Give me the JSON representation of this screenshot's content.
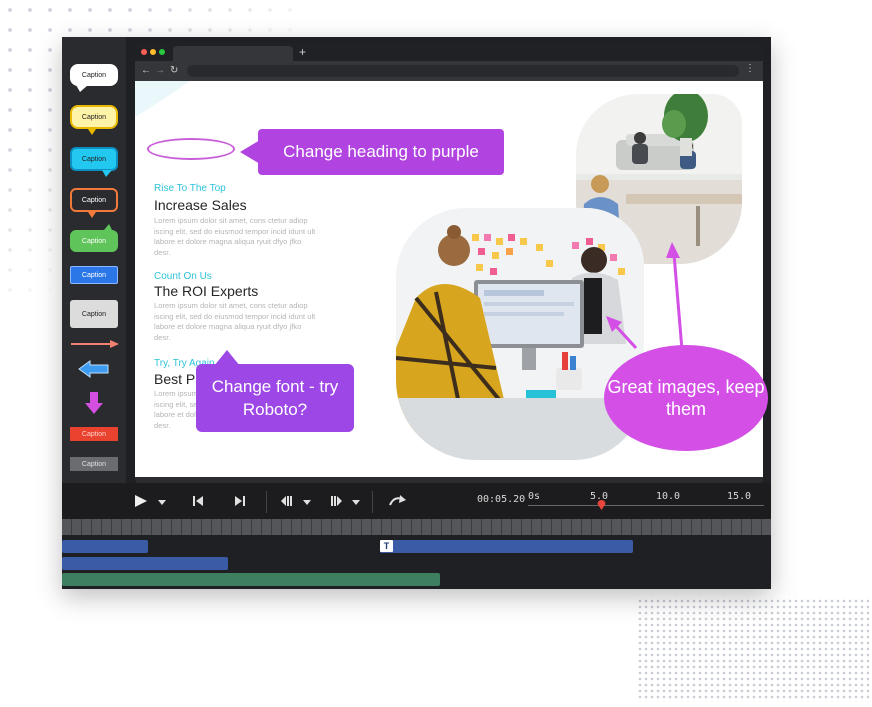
{
  "palette": {
    "items": [
      "Caption",
      "Caption",
      "Caption",
      "Caption",
      "Caption",
      "Caption",
      "Caption",
      "Caption",
      "Caption"
    ]
  },
  "browser": {
    "new_tab_label": "+",
    "menu_label": "⋮"
  },
  "page": {
    "sections": [
      {
        "label": "Rise To The Top",
        "title": "Increase Sales",
        "body": "Lorem ipsum dolor sit amet, cons ctetur adiop iscing elit, sed do eiusmod tempor incid idunt ult labore et dolore magna aliqua ryuit dfyo jfko desr."
      },
      {
        "label": "Count On Us",
        "title": "The ROI Experts",
        "body": "Lorem ipsum dolor sit amet, cons ctetur adiop iscing elit, sed do eiusmod tempor incid idunt ult labore et dolore magna aliqua ryuit dfyo jfko desr."
      },
      {
        "label": "Try, Try Again",
        "title": "Best Practices",
        "body": "Lorem ipsum dolor sit amet, cons ctetur adiop iscing elit, sed do eiusmod tempor incid idunt ult labore et dolore magna aliqua ryuit dfyo jfko desr."
      }
    ]
  },
  "annotations": {
    "heading_callout": "Change heading to purple",
    "font_callout": "Change font - try Roboto?",
    "images_callout": "Great images, keep them"
  },
  "player": {
    "timecode": "00:05.20",
    "ruler_labels": [
      "0s",
      "5.0",
      "10.0",
      "15.0"
    ],
    "playhead_seconds": 5.2
  },
  "timeline": {
    "text_clip_icon": "T"
  },
  "colors": {
    "accent_purple": "#b144e0",
    "heading_cyan": "#2ec3d8",
    "clip_blue": "#3a5ba6",
    "clip_green": "#3e7f60",
    "playhead_red": "#e8453c"
  }
}
